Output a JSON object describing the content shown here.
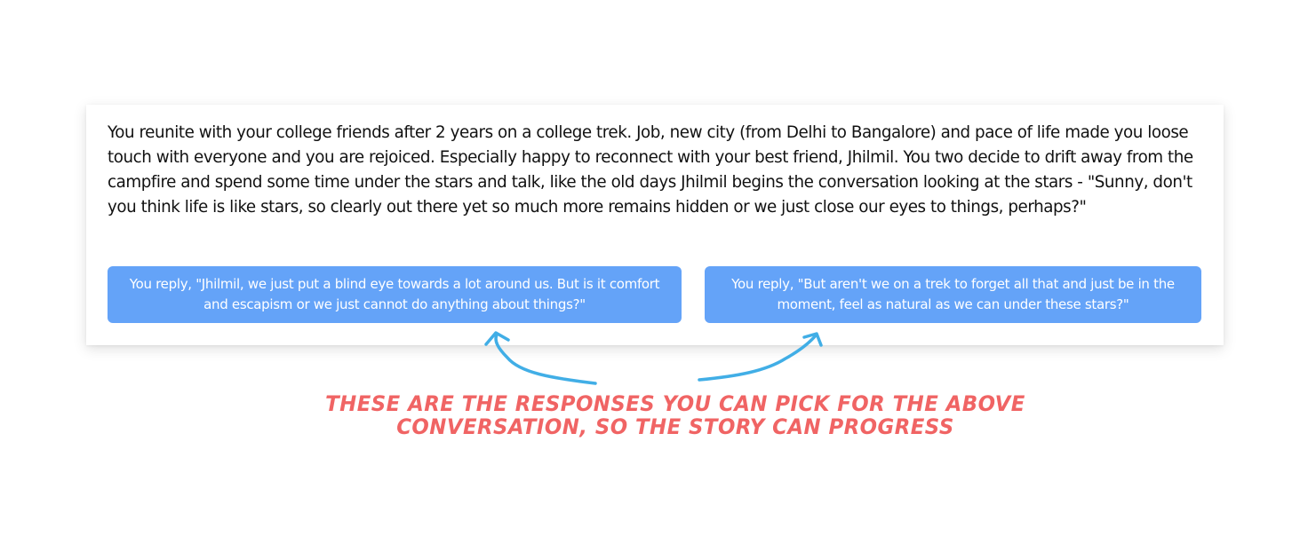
{
  "story": {
    "text": "You reunite with your college friends after 2 years on a college trek. Job, new city (from Delhi to Bangalore) and pace of life made you loose touch with everyone and you are rejoiced. Especially happy to reconnect with your best friend, Jhilmil. You two decide to drift away from the campfire and spend some time under the stars and talk, like the old days Jhilmil begins the conversation looking at the stars - \"Sunny, don't you think life is like stars, so clearly out there yet so much more remains hidden or we just close our eyes to things, perhaps?\""
  },
  "choices": [
    {
      "label": "You reply, \"Jhilmil, we just put a blind eye towards a lot around us. But is it comfort and escapism or we just cannot do anything about things?\""
    },
    {
      "label": "You reply, \"But aren't we on a trek to forget all that and just be in the moment, feel as natural as we can under these stars?\""
    }
  ],
  "annotation": {
    "line1": "These are the responses you can pick for the above",
    "line2": "conversation, so the story can progress"
  },
  "colors": {
    "button": "#64a3f8",
    "arrow": "#41aee6",
    "annotation": "#f06464"
  }
}
